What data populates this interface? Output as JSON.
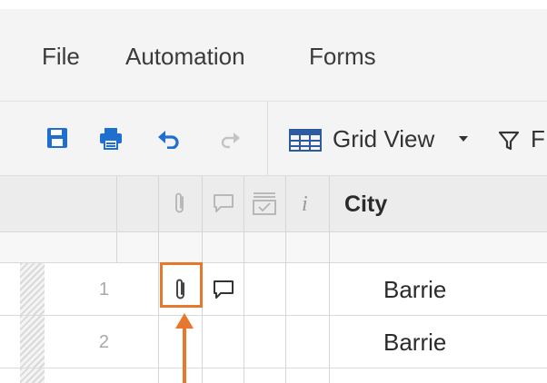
{
  "menubar": {
    "items": [
      {
        "label": "File"
      },
      {
        "label": "Automation"
      },
      {
        "label": "Forms"
      }
    ]
  },
  "toolbar": {
    "save_icon": "floppy-disk-icon",
    "print_icon": "printer-icon",
    "undo_icon": "undo-icon",
    "redo_icon": "redo-icon",
    "grid_view_icon": "grid-table-icon",
    "grid_view_label": "Grid View",
    "filter_label_partial": "F",
    "accent_color": "#1f6fd1",
    "disabled_color": "#c4c4c4"
  },
  "grid": {
    "header": {
      "attachment_icon": "paperclip-icon",
      "comment_icon": "comment-icon",
      "proofing_icon": "proof-inbox-icon",
      "info_label": "i",
      "city_label": "City"
    },
    "rows": [
      {
        "number": "1",
        "has_attachment": true,
        "has_comment": true,
        "city": "Barrie"
      },
      {
        "number": "2",
        "has_attachment": false,
        "has_comment": false,
        "city": "Barrie"
      }
    ]
  },
  "annotation": {
    "color": "#e8772e"
  }
}
